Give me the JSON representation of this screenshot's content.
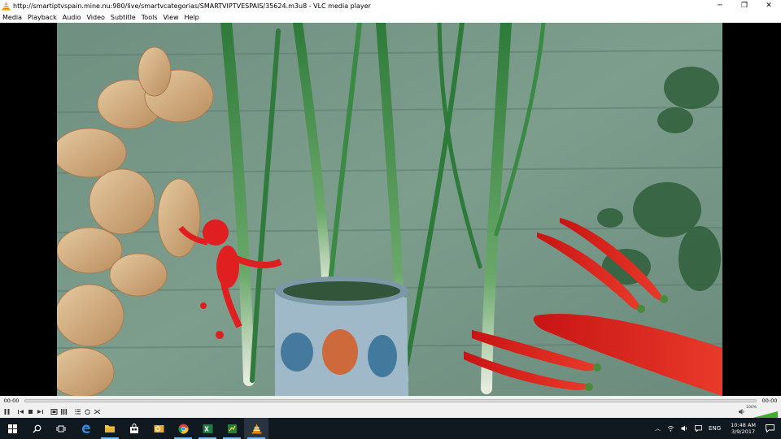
{
  "window": {
    "title": "http://smartiptvspain.mine.nu:980/live/smartvcategorias/SMARTVIPTVESPAIS/35624.m3u8 - VLC media player",
    "minimize_glyph": "─",
    "restore_glyph": "❐",
    "close_glyph": "✕"
  },
  "menu": [
    "Media",
    "Playback",
    "Audio",
    "Video",
    "Subtitle",
    "Tools",
    "View",
    "Help"
  ],
  "seek": {
    "elapsed": "00:00",
    "remaining": "00:00",
    "progress": 0
  },
  "volume": {
    "percent_label": "100%",
    "level": 1.0
  },
  "tray": {
    "language": "ENG",
    "time": "10:48 AM",
    "date": "3/9/2017"
  },
  "colors": {
    "vlc_orange": "#f18a00",
    "taskbar": "#101820",
    "accent": "#76b9ed"
  }
}
